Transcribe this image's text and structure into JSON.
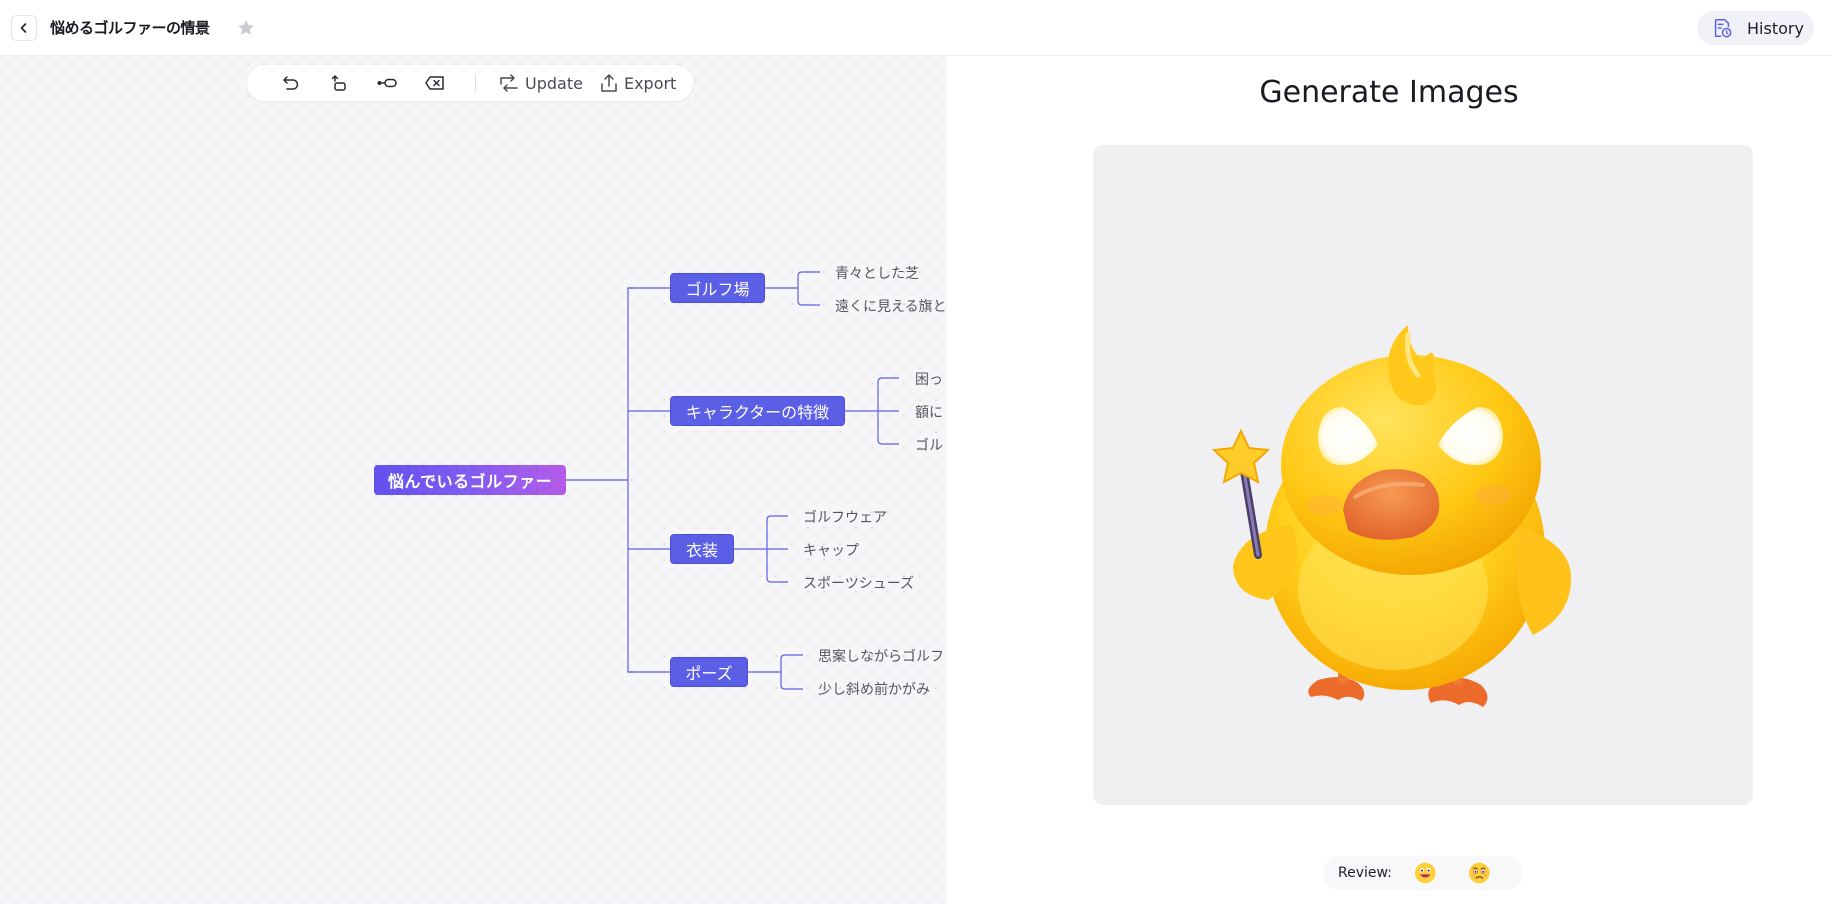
{
  "header": {
    "title": "悩めるゴルファーの情景",
    "history_label": "History",
    "icons": {
      "back": "chevron-left-icon",
      "favorite": "star-icon",
      "history": "history-doc-icon"
    }
  },
  "toolbar": {
    "icons": [
      "undo-icon",
      "redo-icon",
      "add-child-node-icon",
      "delete-node-icon"
    ],
    "update_label": "Update",
    "export_label": "Export"
  },
  "mindmap": {
    "root": "悩んでいるゴルファー",
    "branches": [
      {
        "label": "ゴルフ場",
        "children": [
          "青々とした芝",
          "遠くに見える旗と"
        ]
      },
      {
        "label": "キャラクターの特徴",
        "children": [
          "困っ",
          "額に",
          "ゴル"
        ]
      },
      {
        "label": "衣装",
        "children": [
          "ゴルフウェア",
          "キャップ",
          "スポーツシューズ"
        ]
      },
      {
        "label": "ポーズ",
        "children": [
          "思案しながらゴルフ",
          "少し斜め前かがみ"
        ]
      }
    ]
  },
  "panel": {
    "title": "Generate Images",
    "image": "yellow-duck-with-magic-wand",
    "review_label": "Review:",
    "review_icons": [
      "happy-emoji-icon",
      "sad-emoji-icon"
    ]
  },
  "colors": {
    "accent": "#5b5fe6",
    "root_gradient": [
      "#6251ee",
      "#b45be8"
    ],
    "canvas_bg": "#f6f6f9",
    "duck_yellow": "#ffd21f",
    "beak_orange": "#f0782e"
  }
}
